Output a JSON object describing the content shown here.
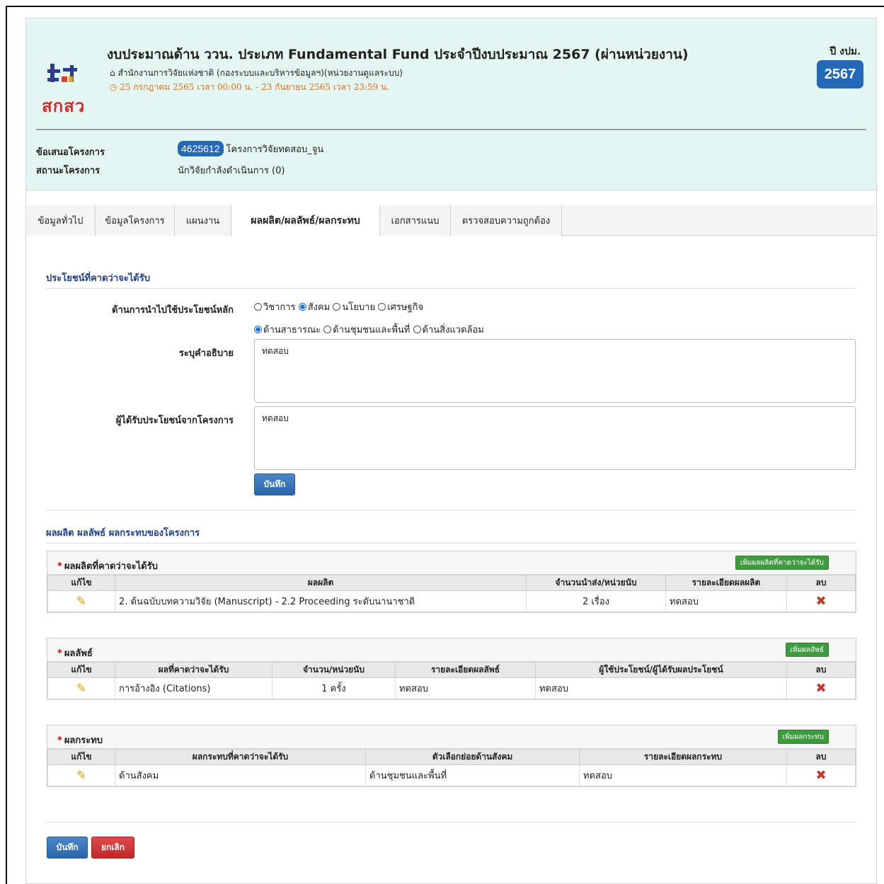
{
  "header": {
    "logo_text": "สกสว",
    "title": "งบประมาณด้าน ววน. ประเภท Fundamental Fund ประจำปีงบประมาณ 2567 (ผ่านหน่วยงาน)",
    "org": "สำนักงานการวิจัยแห่งชาติ (กองระบบและบริหารข้อมูลฯ)(หน่วยงานดูแลระบบ)",
    "period": "25 กรกฎาคม 2565 เวลา 00:00 น. - 23 กันยายน 2565 เวลา 23:59 น.",
    "year_label": "ปี งปม.",
    "year": "2567"
  },
  "meta": {
    "proposal_label": "ข้อเสนอโครงการ",
    "proposal_id": "4625612",
    "proposal_name": "โครงการวิจัยทดสอบ_จูน",
    "status_label": "สถานะโครงการ",
    "status_value": "นักวิจัยกำลังดำเนินการ (0)"
  },
  "tabs": [
    {
      "label": "ข้อมูลทั่วไป"
    },
    {
      "label": "ข้อมูลโครงการ"
    },
    {
      "label": "แผนงาน"
    },
    {
      "label": "ผลผลิต/ผลลัพธ์/ผลกระทบ"
    },
    {
      "label": "เอกสารแนบ"
    },
    {
      "label": "ตรวจสอบความถูกต้อง"
    }
  ],
  "benefits": {
    "section_title": "ประโยชน์ที่คาดว่าจะได้รับ",
    "main_use_label": "ด้านการนำไปใช้ประโยชน์หลัก",
    "options_row1": [
      "วิชาการ",
      "สังคม",
      "นโยบาย",
      "เศรษฐกิจ"
    ],
    "selected_row1": "สังคม",
    "options_row2": [
      "ด้านสาธารณะ",
      "ด้านชุมชนและพื้นที่",
      "ด้านสิ่งแวดล้อม"
    ],
    "selected_row2": "ด้านสาธารณะ",
    "desc_label": "ระบุคำอธิบาย",
    "desc_value": "ทดสอบ",
    "beneficiary_label": "ผู้ได้รับประโยชน์จากโครงการ",
    "beneficiary_value": "ทดสอบ",
    "save_label": "บันทึก"
  },
  "outputs_section_title": "ผลผลิต ผลลัพธ์ ผลกระทบของโครงการ",
  "outputs_panel": {
    "title": "ผลผลิตที่คาดว่าจะได้รับ",
    "add_label": "เพิ่มผลผลิตที่คาดว่าจะได้รับ",
    "columns": [
      "แก้ไข",
      "ผลผลิต",
      "จำนวนนำส่ง/หน่วยนับ",
      "รายละเอียดผลผลิต",
      "ลบ"
    ],
    "rows": [
      {
        "output": "2. ต้นฉบับบทความวิจัย (Manuscript) - 2.2 Proceeding ระดับนานาชาติ",
        "qty": "2 เรื่อง",
        "detail": "ทดสอบ"
      }
    ]
  },
  "outcomes_panel": {
    "title": "ผลลัพธ์",
    "add_label": "เพิ่มผลลัพธ์",
    "columns": [
      "แก้ไข",
      "ผลที่คาดว่าจะได้รับ",
      "จำนวน/หน่วยนับ",
      "รายละเอียดผลลัพธ์",
      "ผู้ใช้ประโยชน์/ผู้ได้รับผลประโยชน์",
      "ลบ"
    ],
    "rows": [
      {
        "outcome": "การอ้างอิง (Citations)",
        "qty": "1 ครั้ง",
        "detail": "ทดสอบ",
        "user": "ทดสอบ"
      }
    ]
  },
  "impacts_panel": {
    "title": "ผลกระทบ",
    "add_label": "เพิ่มผลกระทบ",
    "columns": [
      "แก้ไข",
      "ผลกระทบที่คาดว่าจะได้รับ",
      "ตัวเลือกย่อยด้านสังคม",
      "รายละเอียดผลกระทบ",
      "ลบ"
    ],
    "rows": [
      {
        "impact": "ด้านสังคม",
        "sub": "ด้านชุมชนและพื้นที่",
        "detail": "ทดสอบ"
      }
    ]
  },
  "footer": {
    "save_label": "บันทึก",
    "cancel_label": "ยกเลิก"
  },
  "icons": {
    "edit": "pencil-icon",
    "delete": "delete-x-icon",
    "home": "home-icon",
    "clock": "clock-icon"
  },
  "colors": {
    "header_bg": "#e4f6f1",
    "badge_blue": "#2468b8",
    "period_orange": "#e0701a",
    "section_title": "#1f3f8f",
    "add_green": "#3f9b3f",
    "cancel_red": "#c02828"
  }
}
